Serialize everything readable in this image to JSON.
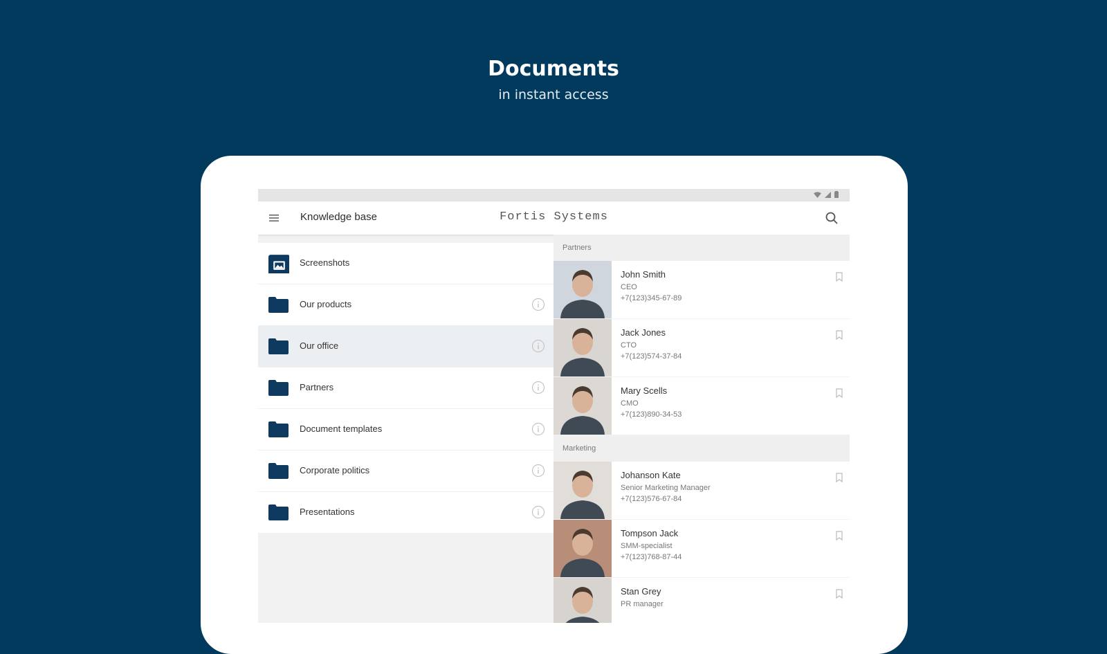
{
  "hero": {
    "title": "Documents",
    "subtitle": "in instant access"
  },
  "appbar": {
    "title": "Knowledge base",
    "brand": "Fortis Systems"
  },
  "folders": [
    {
      "label": "Screenshots",
      "icon": "image-icon",
      "has_info": false,
      "selected": false
    },
    {
      "label": "Our products",
      "icon": "folder-icon",
      "has_info": true,
      "selected": false
    },
    {
      "label": "Our office",
      "icon": "folder-icon",
      "has_info": true,
      "selected": true
    },
    {
      "label": "Partners",
      "icon": "folder-icon",
      "has_info": true,
      "selected": false
    },
    {
      "label": "Document templates",
      "icon": "folder-icon",
      "has_info": true,
      "selected": false
    },
    {
      "label": "Corporate politics",
      "icon": "folder-icon",
      "has_info": true,
      "selected": false
    },
    {
      "label": "Presentations",
      "icon": "folder-icon",
      "has_info": true,
      "selected": false
    }
  ],
  "sections": [
    {
      "title": "Partners",
      "contacts": [
        {
          "name": "John Smith",
          "role": "CEO",
          "phone": "+7(123)345-67-89",
          "photo_bg": "#cfd6dd"
        },
        {
          "name": "Jack Jones",
          "role": "CTO",
          "phone": "+7(123)574-37-84",
          "photo_bg": "#d9d6d2"
        },
        {
          "name": "Mary Scells",
          "role": "CMO",
          "phone": "+7(123)890-34-53",
          "photo_bg": "#dcd8d3"
        }
      ]
    },
    {
      "title": "Marketing",
      "contacts": [
        {
          "name": "Johanson Kate",
          "role": "Senior Marketing Manager",
          "phone": "+7(123)576-67-84",
          "photo_bg": "#e1ddd8"
        },
        {
          "name": "Tompson Jack",
          "role": "SMM-specialist",
          "phone": "+7(123)768-87-44",
          "photo_bg": "#b98e79"
        },
        {
          "name": "Stan Grey",
          "role": "PR manager",
          "phone": "",
          "photo_bg": "#d7d4d0"
        }
      ]
    }
  ],
  "colors": {
    "background": "#023a5e",
    "folder": "#0f3a5f",
    "accent": "#0f3a5f"
  }
}
